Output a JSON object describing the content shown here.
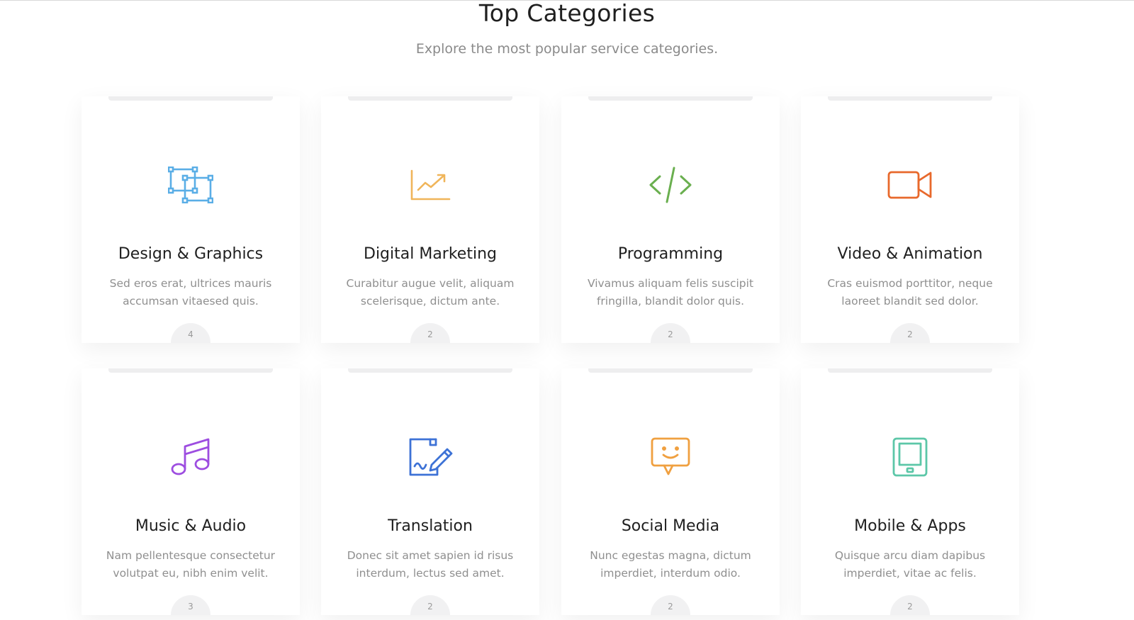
{
  "section": {
    "title": "Top Categories",
    "subtitle": "Explore the most popular service categories."
  },
  "categories": [
    {
      "name": "Design & Graphics",
      "description": "Sed eros erat, ultrices mauris accumsan vitaesed quis.",
      "count": "4",
      "icon": "design-graphics-icon",
      "color": "#5aaee6"
    },
    {
      "name": "Digital Marketing",
      "description": "Curabitur augue velit, aliquam scelerisque, dictum ante.",
      "count": "2",
      "icon": "chart-trend-icon",
      "color": "#f0b55a"
    },
    {
      "name": "Programming",
      "description": "Vivamus aliquam felis suscipit fringilla, blandit dolor quis.",
      "count": "2",
      "icon": "code-icon",
      "color": "#6aaf4f"
    },
    {
      "name": "Video & Animation",
      "description": "Cras euismod porttitor, neque laoreet blandit sed dolor.",
      "count": "2",
      "icon": "video-camera-icon",
      "color": "#e8692c"
    },
    {
      "name": "Music & Audio",
      "description": "Nam pellentesque consectetur volutpat eu, nibh enim velit.",
      "count": "3",
      "icon": "music-note-icon",
      "color": "#9d4de0"
    },
    {
      "name": "Translation",
      "description": "Donec sit amet sapien id risus interdum, lectus sed amet.",
      "count": "2",
      "icon": "document-pen-icon",
      "color": "#3d72d6"
    },
    {
      "name": "Social Media",
      "description": "Nunc egestas magna, dictum imperdiet, interdum odio.",
      "count": "2",
      "icon": "chat-smile-icon",
      "color": "#f0a040"
    },
    {
      "name": "Mobile & Apps",
      "description": "Quisque arcu diam dapibus imperdiet, vitae ac felis.",
      "count": "2",
      "icon": "tablet-icon",
      "color": "#5cc7a8"
    }
  ]
}
